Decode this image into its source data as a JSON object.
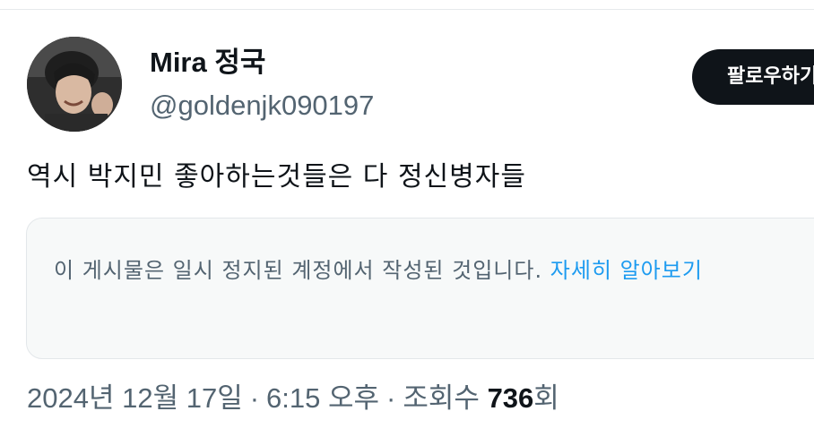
{
  "author": {
    "display_name": "Mira 정국",
    "handle": "@goldenjk090197"
  },
  "follow_button": {
    "label": "팔로우하기"
  },
  "tweet": {
    "text": "역시 박지민 좋아하는것들은 다 정신병자들"
  },
  "notice": {
    "text": "이 게시물은 일시 정지된 계정에서 작성된 것입니다.",
    "link_label": "자세히 알아보기"
  },
  "meta": {
    "date": "2024년 12월 17일",
    "separator": "·",
    "time": "6:15 오후",
    "views_label": "조회수",
    "views_count": "736",
    "views_suffix": "회"
  },
  "colors": {
    "text_primary": "#0f1419",
    "text_secondary": "#536471",
    "link": "#1d9bf0",
    "notice_background": "#f7f9f9",
    "follow_button_background": "#0f1419"
  }
}
